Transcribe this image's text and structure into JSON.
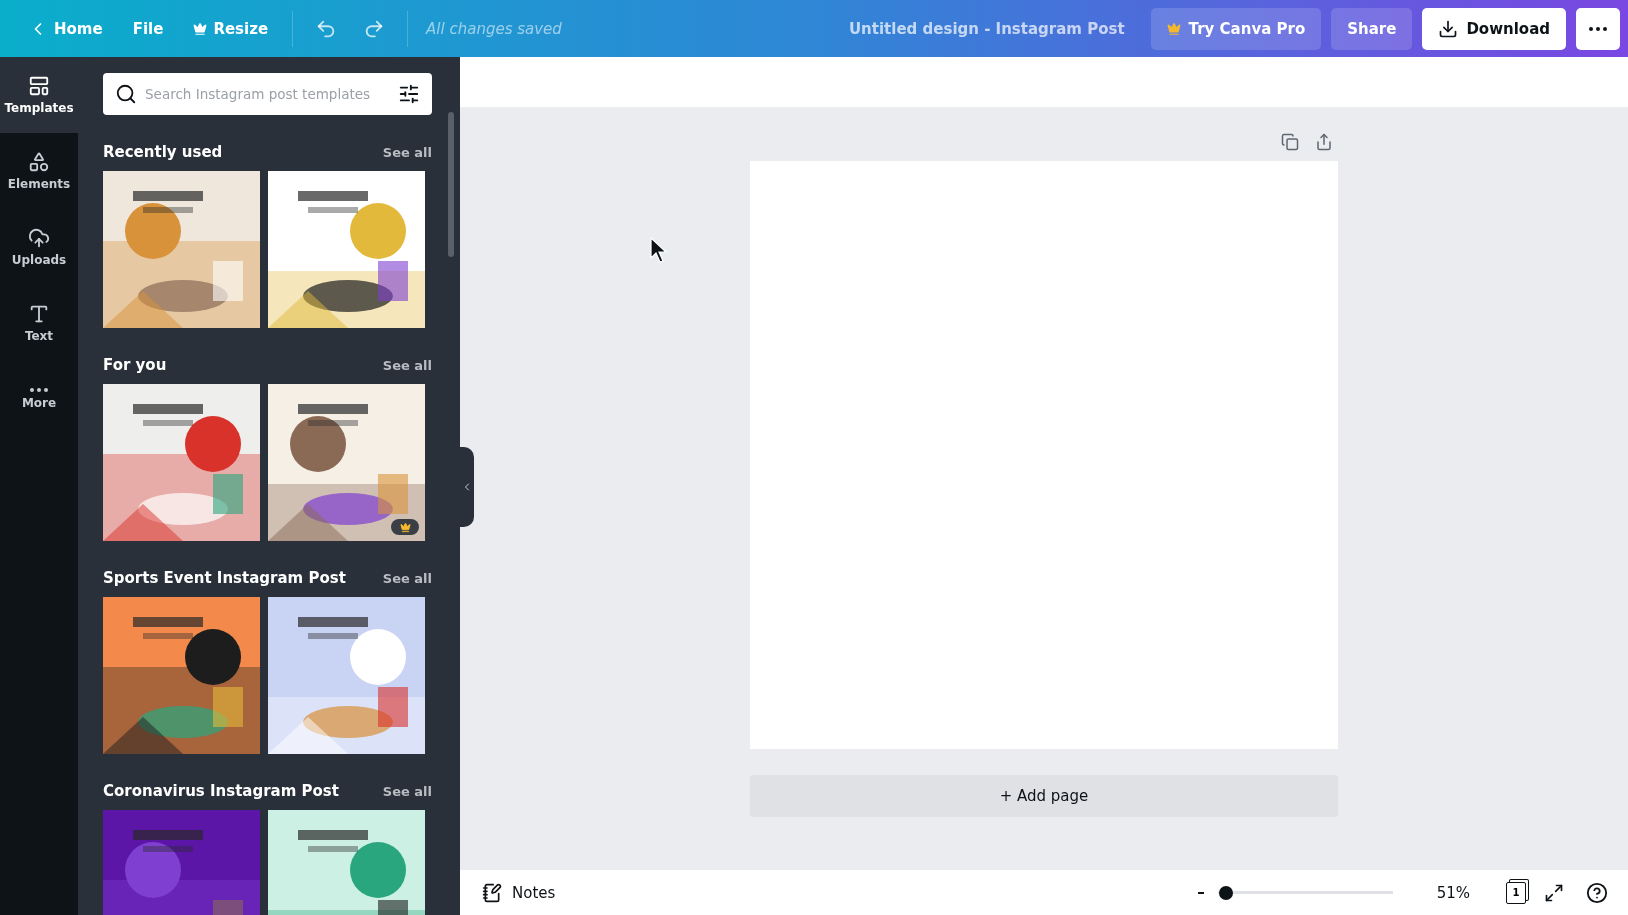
{
  "topbar": {
    "nav": [
      {
        "kind": "back",
        "label": "Home"
      },
      {
        "kind": "plain",
        "label": "File"
      },
      {
        "kind": "crown",
        "label": "Resize"
      }
    ],
    "status": "All changes saved",
    "title": "Untitled design - Instagram Post",
    "buttons": [
      {
        "kind": "pro",
        "label": "Try Canva Pro"
      },
      {
        "kind": "plain",
        "label": "Share"
      },
      {
        "kind": "download",
        "label": "Download"
      }
    ]
  },
  "rail": [
    {
      "kind": "templates",
      "label": "Templates",
      "selected": true
    },
    {
      "kind": "elements",
      "label": "Elements",
      "selected": false
    },
    {
      "kind": "uploads",
      "label": "Uploads",
      "selected": false
    },
    {
      "kind": "text",
      "label": "Text",
      "selected": false
    },
    {
      "kind": "more",
      "label": "More",
      "selected": false
    }
  ],
  "panel": {
    "search": {
      "placeholder": "Search Instagram post templates"
    },
    "sections": [
      {
        "title": "Recently used",
        "action": "See all",
        "templates": [
          {
            "kind": "picture",
            "pro": false
          },
          {
            "kind": "picture",
            "pro": false
          }
        ]
      },
      {
        "title": "For you",
        "action": "See all",
        "templates": [
          {
            "kind": "picture",
            "pro": false
          },
          {
            "kind": "picture",
            "pro": true
          }
        ]
      },
      {
        "title": "Sports Event Instagram Post",
        "action": "See all",
        "templates": [
          {
            "kind": "picture",
            "pro": false
          },
          {
            "kind": "picture",
            "pro": false
          }
        ]
      },
      {
        "title": "Coronavirus Instagram Post",
        "action": "See all",
        "templates": [
          {
            "kind": "picture"
          },
          {
            "kind": "picture"
          }
        ]
      }
    ]
  },
  "canvas": {
    "add_page": "+ Add page"
  },
  "footer": {
    "notes": "Notes",
    "zoom": {
      "level": 0.05,
      "reading": "51%"
    },
    "pages": "1"
  }
}
